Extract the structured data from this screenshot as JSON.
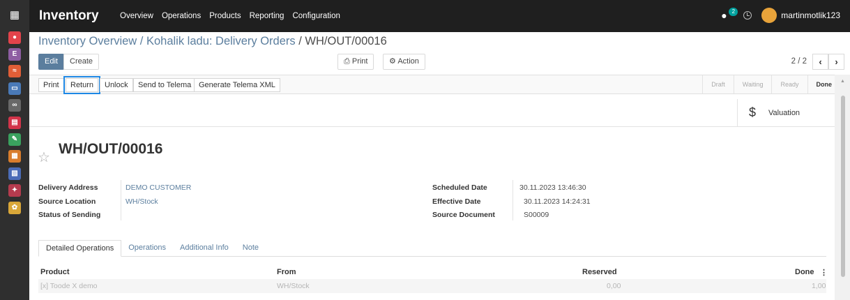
{
  "navbar": {
    "brand": "Inventory",
    "menu": [
      "Overview",
      "Operations",
      "Products",
      "Reporting",
      "Configuration"
    ],
    "chat_count": "2",
    "username": "martinmotlik123"
  },
  "apps": [
    {
      "name": "discuss-app-icon",
      "color": "#e3434b",
      "glyph": "●"
    },
    {
      "name": "employees-app-icon",
      "color": "#8e5ea2",
      "glyph": "E"
    },
    {
      "name": "reporting-app-icon",
      "color": "#e05e37",
      "glyph": "≈"
    },
    {
      "name": "invoicing-app-icon",
      "color": "#4a7ab8",
      "glyph": "▭"
    },
    {
      "name": "link-app-icon",
      "color": "#686868",
      "glyph": "∞"
    },
    {
      "name": "inventory-app-icon",
      "color": "#d2344a",
      "glyph": "▤"
    },
    {
      "name": "tools-app-icon",
      "color": "#3aa15e",
      "glyph": "✎"
    },
    {
      "name": "documents-app-icon",
      "color": "#d97d2c",
      "glyph": "▦"
    },
    {
      "name": "sheets-app-icon",
      "color": "#4b6cb7",
      "glyph": "▧"
    },
    {
      "name": "apps-app-icon",
      "color": "#b43b4e",
      "glyph": "✦"
    },
    {
      "name": "settings-app-icon",
      "color": "#d9a739",
      "glyph": "✿"
    }
  ],
  "breadcrumb": {
    "parent": "Inventory Overview / Kohalik ladu: Delivery Orders",
    "separator": " / ",
    "current": "WH/OUT/00016"
  },
  "control": {
    "edit": "Edit",
    "create": "Create",
    "print": "Print",
    "action": "Action",
    "pager": "2 / 2"
  },
  "status_buttons": [
    "Print",
    "Return",
    "Unlock",
    "Send to Telema",
    "Generate Telema XML"
  ],
  "stages": [
    "Draft",
    "Waiting",
    "Ready",
    "Done"
  ],
  "active_stage": "Done",
  "valuation": "Valuation",
  "record_title": "WH/OUT/00016",
  "fields_left": [
    {
      "label": "Delivery Address",
      "value": "DEMO CUSTOMER"
    },
    {
      "label": "Source Location",
      "value": "WH/Stock"
    },
    {
      "label": "Status of Sending",
      "value": ""
    }
  ],
  "fields_right": [
    {
      "label": "Scheduled Date",
      "value": "30.11.2023 13:46:30"
    },
    {
      "label": "Effective Date",
      "value": "30.11.2023 14:24:31"
    },
    {
      "label": "Source Document",
      "value": "S00009"
    }
  ],
  "tabs": [
    "Detailed Operations",
    "Operations",
    "Additional Info",
    "Note"
  ],
  "table": {
    "columns": [
      "Product",
      "From",
      "Reserved",
      "Done"
    ],
    "rows": [
      [
        "[x] Toode X demo",
        "WH/Stock",
        "0,00",
        "1,00"
      ]
    ]
  }
}
